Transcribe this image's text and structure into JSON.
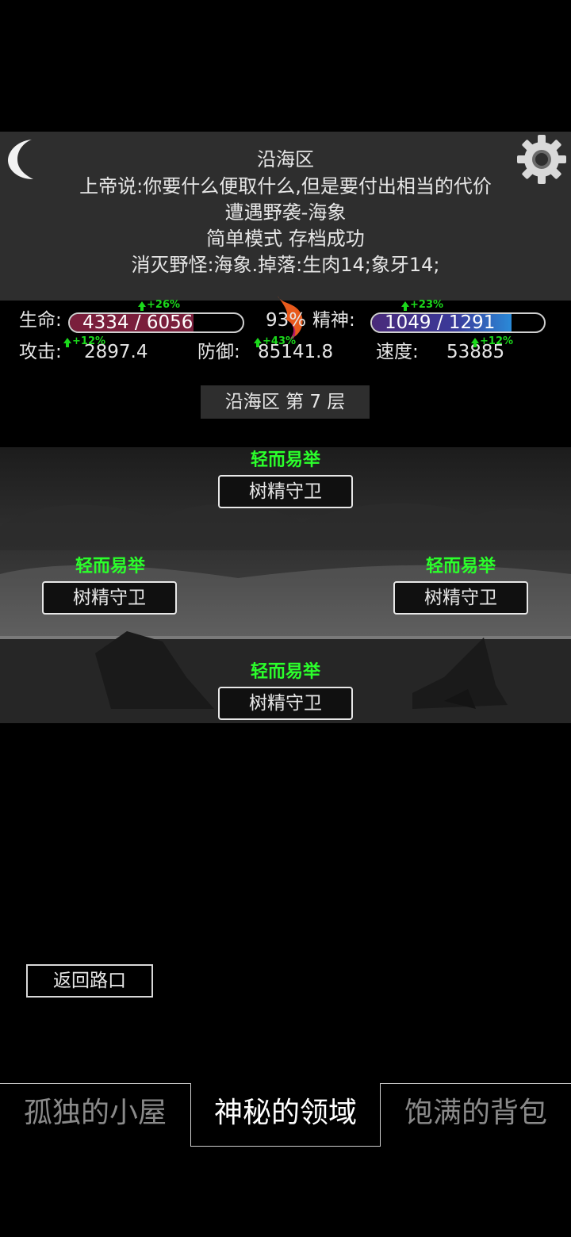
{
  "header": {
    "location": "沿海区",
    "messages": [
      "上帝说:你要什么便取什么,但是要付出相当的代价",
      "遭遇野袭-海象",
      "简单模式 存档成功",
      "消灭野怪:海象.掉落:生肉14;象牙14;"
    ],
    "left_icon": "moon-icon",
    "right_icon": "gear-icon"
  },
  "stats": {
    "hp_label": "生命:",
    "hp_value": "4334 / 6056",
    "hp_fill": 0.716,
    "hp_boost": "+26%",
    "center_percent": "93%",
    "mp_label": "精神:",
    "mp_value": "1049 / 1291",
    "mp_fill": 0.813,
    "mp_boost": "+23%",
    "attack_label": "攻击:",
    "attack_value": "2897.4",
    "attack_boost": "+12%",
    "defense_label": "防御:",
    "defense_value": "85141.8",
    "defense_boost": "+43%",
    "speed_label": "速度:",
    "speed_value": "53885",
    "speed_boost": "+12%",
    "colors": {
      "hp": "#7a1f3c",
      "mp": "#4a2a7a",
      "boost": "#1bd91b"
    }
  },
  "floor_title": "沿海区 第 7 层",
  "enemies": [
    {
      "difficulty": "轻而易举",
      "name": "树精守卫"
    },
    {
      "difficulty": "轻而易举",
      "name": "树精守卫"
    },
    {
      "difficulty": "轻而易举",
      "name": "树精守卫"
    },
    {
      "difficulty": "轻而易举",
      "name": "树精守卫"
    }
  ],
  "back_button": "返回路口",
  "tabs": [
    {
      "label": "孤独的小屋",
      "active": false
    },
    {
      "label": "神秘的领域",
      "active": true
    },
    {
      "label": "饱满的背包",
      "active": false
    }
  ]
}
